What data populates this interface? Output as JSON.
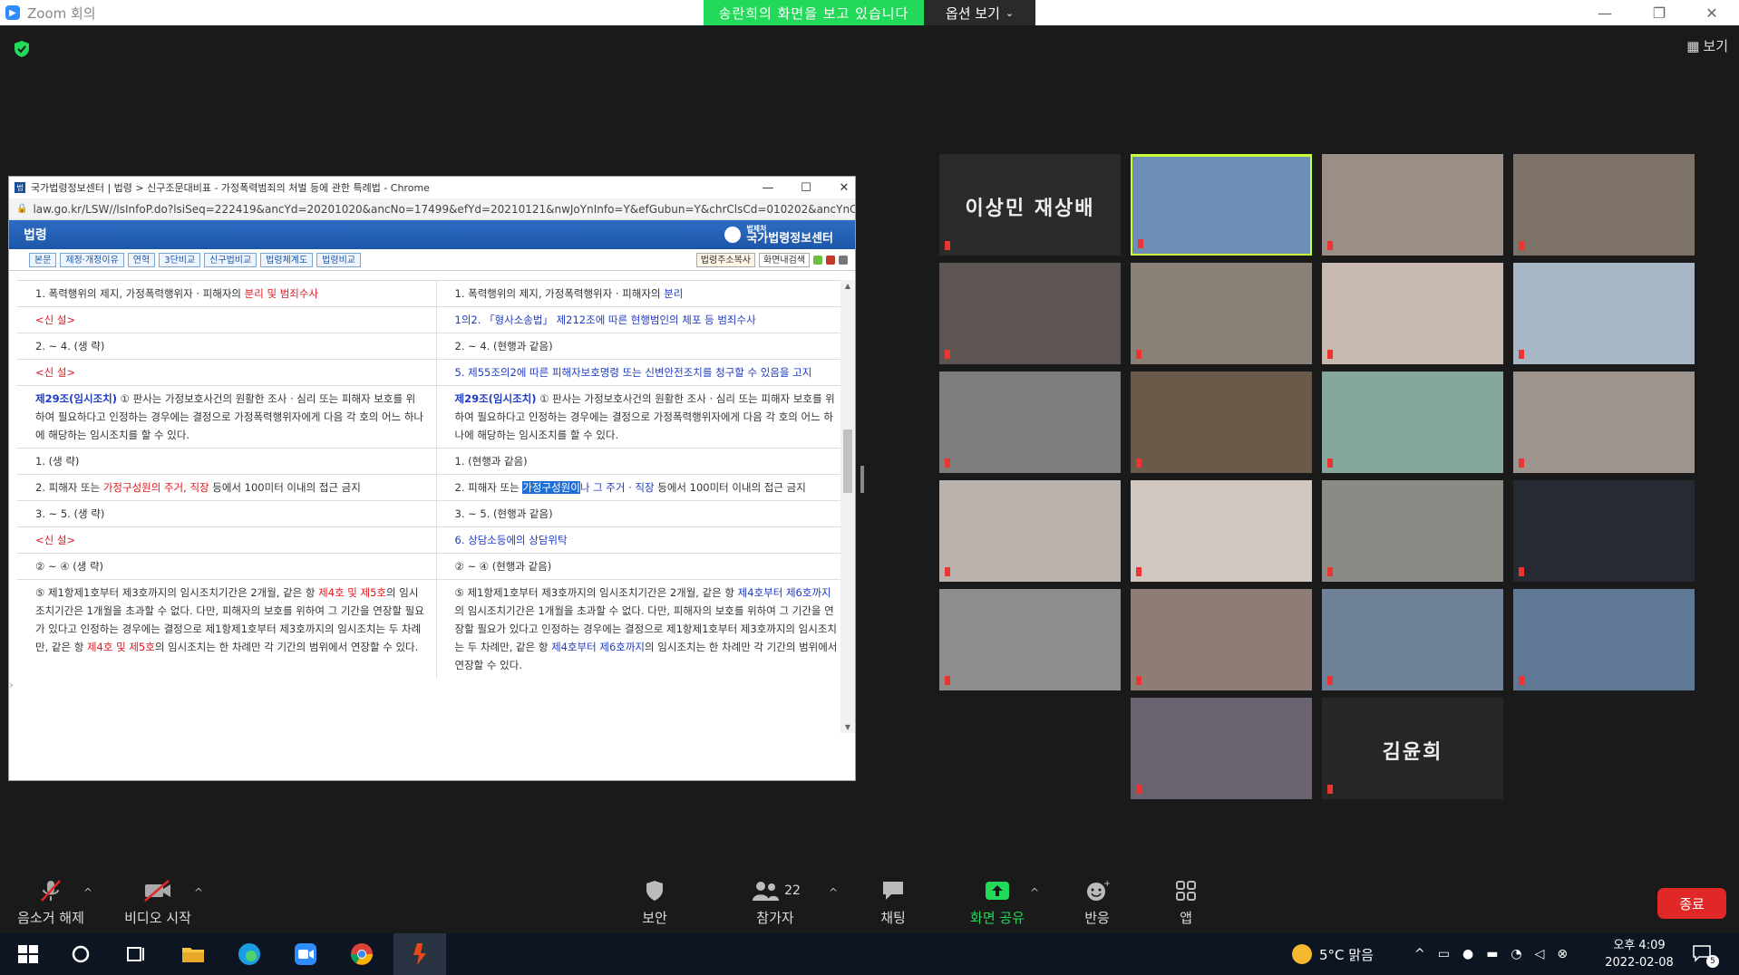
{
  "zoom": {
    "app_title": "Zoom 회의",
    "share_banner": "송란희의 화면을 보고 있습니다",
    "view_options": "옵션 보기",
    "view_button": "보기",
    "participants_count": "22",
    "end_label": "종료"
  },
  "chrome": {
    "window_title": "국가법령정보센터 | 법령 > 신구조문대비표 - 가정폭력범죄의 처벌 등에 관한 특례법 - Chrome",
    "url": "law.go.kr/LSW//lsInfoP.do?lsiSeq=222419&ancYd=20201020&ancNo=17499&efYd=20210121&nwJoYnInfo=Y&efGubun=Y&chrClsCd=010202&ancYnCh...",
    "header_title": "법령",
    "logo_small": "법제처",
    "logo_text": "국가법령정보센터",
    "tabs": [
      "본문",
      "제정·개정이유",
      "연혁",
      "3단비교",
      "신구법비교",
      "법령체계도",
      "법령비교"
    ],
    "right_tools": [
      "법령주소복사",
      "화면내검색"
    ]
  },
  "law_rows": [
    {
      "left": "1. 폭력행위의 제지, 가정폭력행위자 · 피해자의 ",
      "left_red": "분리 및 범죄수사",
      "right": "1. 폭력행위의 제지, 가정폭력행위자 · 피해자의 ",
      "right_blue": "분리"
    },
    {
      "left_red_only": "<신 설>",
      "right_blue_only": "1의2. 「형사소송법」 제212조에 따른 현행범인의 체포 등 범죄수사"
    },
    {
      "left": "2. ~ 4. (생 략)",
      "right": "2. ~ 4. (현행과 같음)"
    },
    {
      "left_red_only": "<신 설>",
      "right_blue_only": "5. 제55조의2에 따른 피해자보호명령 또는 신변안전조치를 청구할 수 있음을 고지"
    },
    {
      "left_bold": "제29조(임시조치)",
      "left": " ① 판사는 가정보호사건의 원활한 조사 · 심리 또는 피해자 보호를 위하여 필요하다고 인정하는 경우에는 결정으로 가정폭력행위자에게 다음 각 호의 어느 하나에 해당하는 임시조치를 할 수 있다.",
      "right_bold": "제29조(임시조치)",
      "right": " ① 판사는 가정보호사건의 원활한 조사 · 심리 또는 피해자 보호를 위하여 필요하다고 인정하는 경우에는 결정으로 가정폭력행위자에게 다음 각 호의 어느 하나에 해당하는 임시조치를 할 수 있다."
    },
    {
      "left": "1. (생 략)",
      "right": "1. (현행과 같음)"
    },
    {
      "left": "2. 피해자 또는 ",
      "left_red": "가정구성원의 주거, 직장",
      "left_tail": " 등에서 100미터 이내의 접근 금지",
      "right": "2. 피해자 또는 ",
      "right_hl": "가정구성원이",
      "right_blue": "나 그 주거 · 직장",
      "right_tail": " 등에서 100미터 이내의 접근 금지"
    },
    {
      "left": "3. ~ 5. (생 략)",
      "right": "3. ~ 5. (현행과 같음)"
    },
    {
      "left_red_only": "<신 설>",
      "right_blue_only": "6. 상담소등에의 상담위탁"
    },
    {
      "left": "② ~ ④ (생 략)",
      "right": "② ~ ④ (현행과 같음)"
    },
    {
      "left": "⑤ 제1항제1호부터 제3호까지의 임시조치기간은 2개월, 같은 항 ",
      "left_red": "제4호 및 제5호",
      "left_tail": "의 임시조치기간은 1개월을 초과할 수 없다. 다만, 피해자의 보호를 위하여 그 기간을 연장할 필요가 있다고 인정하는 경우에는 결정으로 제1항제1호부터 제3호까지의 임시조치는 두 차례만, 같은 항 ",
      "left_red2": "제4호 및 제5호",
      "left_tail2": "의 임시조치는 한 차례만 각 기간의 범위에서 연장할 수 있다.",
      "right": "⑤ 제1항제1호부터 제3호까지의 임시조치기간은 2개월, 같은 항 ",
      "right_blue": "제4호부터 제6호까지",
      "right_tail": "의 임시조치기간은 1개월을 초과할 수 없다. 다만, 피해자의 보호를 위하여 그 기간을 연장할 필요가 있다고 인정하는 경우에는 결정으로 제1항제1호부터 제3호까지의 임시조치는 두 차례만, 같은 항 ",
      "right_blue2": "제4호부터 제6호까지",
      "right_tail2": "의 임시조치는 한 차례만 각 기간의 범위에서 연장할 수 있다."
    }
  ],
  "tiles": [
    {
      "text": "이상민 재상배",
      "color": "#2b2b2b"
    },
    {
      "text": "",
      "color": "#6e8fb5"
    },
    {
      "text": "",
      "color": "#9a8e86"
    },
    {
      "text": "",
      "color": "#7c7268"
    },
    {
      "text": "",
      "color": "#5d5551"
    },
    {
      "text": "",
      "color": "#8a8278"
    },
    {
      "text": "",
      "color": "#c7b9b0"
    },
    {
      "text": "",
      "color": "#a7b6c4"
    },
    {
      "text": "",
      "color": "#7d7d7d"
    },
    {
      "text": "",
      "color": "#6a5a4a"
    },
    {
      "text": "",
      "color": "#86a79e"
    },
    {
      "text": "",
      "color": "#9d958d"
    },
    {
      "text": "",
      "color": "#b9b2ad"
    },
    {
      "text": "",
      "color": "#cfc7c0"
    },
    {
      "text": "",
      "color": "#8c8a84"
    },
    {
      "text": "",
      "color": "#262a33"
    },
    {
      "text": "",
      "color": "#8e8e8e"
    },
    {
      "text": "",
      "color": "#8d7d74"
    },
    {
      "text": "",
      "color": "#6f8196"
    },
    {
      "text": "",
      "color": "#5f7894"
    },
    {
      "text": "",
      "color": "#6b6470"
    },
    {
      "text": "김윤희",
      "color": "#262626"
    }
  ],
  "toolbar": {
    "mute": "음소거 해제",
    "video": "비디오 시작",
    "security": "보안",
    "participants": "참가자",
    "chat": "채팅",
    "share": "화면 공유",
    "reactions": "반응",
    "apps": "앱"
  },
  "taskbar": {
    "weather": "5°C 맑음",
    "time": "오후 4:09",
    "date": "2022-02-08",
    "notif_count": "5"
  }
}
